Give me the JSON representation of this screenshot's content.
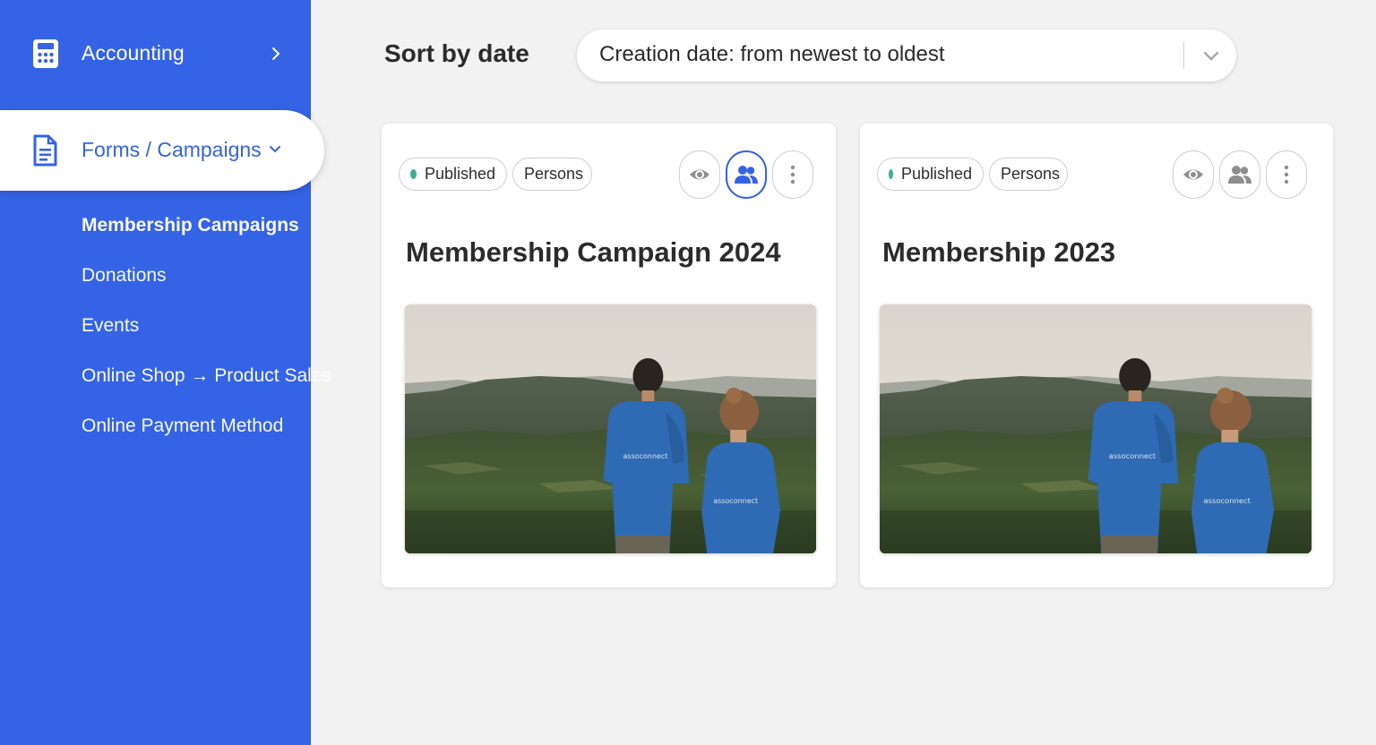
{
  "sidebar": {
    "accounting": {
      "label": "Accounting",
      "icon": "calculator-icon"
    },
    "forms": {
      "label": "Forms / Campaigns",
      "icon": "document-icon"
    },
    "subitems": [
      {
        "label": "Membership Campaigns",
        "current": true
      },
      {
        "label": "Donations"
      },
      {
        "label": "Events"
      },
      {
        "label": "Online Shop → Product Sales"
      },
      {
        "label": "Online Payment Method"
      }
    ],
    "colors": {
      "background": "#3563e6",
      "active_text": "#3563e6"
    }
  },
  "sort": {
    "title": "Sort by date",
    "selected": "Creation date: from newest to oldest"
  },
  "cards": [
    {
      "status": "Published",
      "audience": "Persons",
      "title": "Membership Campaign 2024",
      "persons_active": true,
      "shirt_logo": "assoconnect"
    },
    {
      "status": "Published",
      "audience": "Persons",
      "title": "Membership 2023",
      "persons_active": false,
      "shirt_logo": "assoconnect"
    }
  ],
  "colors": {
    "published_dot": "#3bb08f",
    "accent": "#3563e6"
  }
}
